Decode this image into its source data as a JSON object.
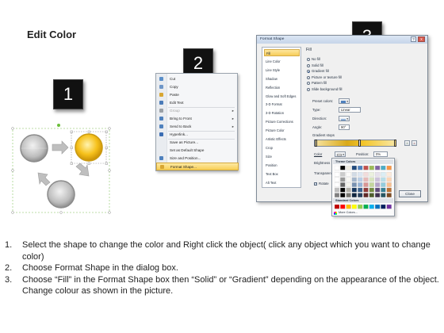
{
  "page": {
    "title": "Edit Color"
  },
  "badges": [
    "1",
    "2",
    "3"
  ],
  "colors": {
    "shape_gray": "#b7b7b7",
    "shape_yellow": "#f6c11b",
    "highlight": "#f8cf55",
    "badge_bg": "#111111",
    "selection_green": "#6bbf3a"
  },
  "context_menu": {
    "items": [
      {
        "label": "Cut",
        "icon": "scissors-icon",
        "disabled": false
      },
      {
        "label": "Copy",
        "icon": "copy-icon",
        "disabled": false
      },
      {
        "label": "Paste",
        "icon": "paste-icon",
        "disabled": false
      },
      {
        "label": "Edit Text",
        "icon": "edit-text-icon",
        "disabled": false
      },
      {
        "label": "Group",
        "icon": "group-icon",
        "disabled": true,
        "submenu": true
      },
      {
        "label": "Bring to Front",
        "icon": "bring-front-icon",
        "disabled": false,
        "submenu": true
      },
      {
        "label": "Send to Back",
        "icon": "send-back-icon",
        "disabled": false,
        "submenu": true
      },
      {
        "label": "Hyperlink...",
        "icon": "hyperlink-icon",
        "disabled": false
      },
      {
        "label": "Save as Picture...",
        "icon": "",
        "disabled": false
      },
      {
        "label": "Set as Default Shape",
        "icon": "",
        "disabled": false
      },
      {
        "label": "Size and Position...",
        "icon": "size-icon",
        "disabled": false
      },
      {
        "label": "Format Shape...",
        "icon": "format-shape-icon",
        "disabled": false,
        "highlighted": true
      }
    ]
  },
  "dialog": {
    "title": "Format Shape",
    "help": "?",
    "close_x": "x",
    "nav": [
      "Fill",
      "Line Color",
      "Line Style",
      "Shadow",
      "Reflection",
      "Glow and Soft Edges",
      "3-D Format",
      "3-D Rotation",
      "Picture Corrections",
      "Picture Color",
      "Artistic Effects",
      "Crop",
      "Size",
      "Position",
      "Text Box",
      "Alt Text"
    ],
    "nav_selected": 0,
    "section_title": "Fill",
    "fill_options": [
      {
        "label": "No fill",
        "on": false
      },
      {
        "label": "Solid fill",
        "on": false
      },
      {
        "label": "Gradient fill",
        "on": true
      },
      {
        "label": "Picture or texture fill",
        "on": false
      },
      {
        "label": "Pattern fill",
        "on": false
      },
      {
        "label": "Slide background fill",
        "on": false
      }
    ],
    "preset_label": "Preset colors:",
    "type_label": "Type:",
    "type_value": "Linear",
    "direction_label": "Direction:",
    "angle_label": "Angle:",
    "angle_value": "90°",
    "stops_label": "Gradient stops",
    "color_label": "Color",
    "position_label": "Position:",
    "position_value": "0%",
    "brightness_label": "Brightness",
    "transparency_label": "Transparen",
    "rotate_label": "Rotate",
    "close_label": "Close"
  },
  "picker": {
    "theme_header": "Theme Colors",
    "standard_header": "Standard Colors",
    "more_label": "More Colors...",
    "theme_top": [
      "#ffffff",
      "#000000",
      "#eeece1",
      "#1f497d",
      "#4f81bd",
      "#c0504d",
      "#9bbb59",
      "#8064a2",
      "#4bacc6",
      "#f79646"
    ],
    "standard": [
      "#c00000",
      "#ff0000",
      "#ffc000",
      "#ffff00",
      "#92d050",
      "#00b050",
      "#00b0f0",
      "#0070c0",
      "#002060",
      "#7030a0"
    ]
  },
  "steps": [
    {
      "num": "1.",
      "text": "Select the shape to change the color and Right click the object( click any object which you want to change color)"
    },
    {
      "num": "2.",
      "text": "Choose Format Shape in the dialog box."
    },
    {
      "num": "3.",
      "text": "Choose “Fill” in the Format Shape box then “Solid” or “Gradient” depending on the appearance of the object. Change colour as shown in the picture."
    }
  ]
}
